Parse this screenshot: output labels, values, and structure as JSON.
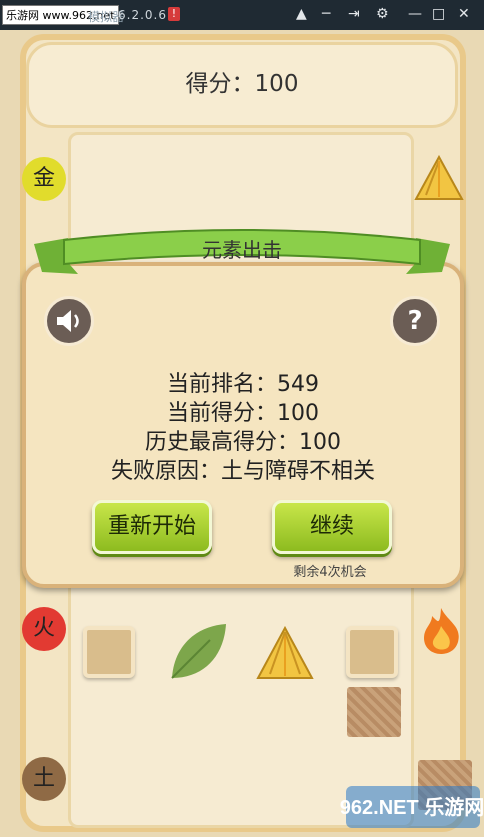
{
  "topbar": {
    "watermark": "乐游网 www.962.net",
    "app_title": "模拟器",
    "version": "6.2.0.6",
    "alert_badge": "!",
    "controls": [
      "shirt-icon",
      "minimize-icon",
      "pin-icon",
      "gear-icon",
      "maximize-icon",
      "close-icon"
    ]
  },
  "game": {
    "score_text": "得分：100",
    "elements": {
      "gold": "金",
      "fire": "火",
      "earth": "土"
    }
  },
  "dialog": {
    "title": "元素出击",
    "sound_icon": "speaker-icon",
    "help_label": "?",
    "rank_line": "当前排名：549",
    "score_line": "当前得分：100",
    "best_line": "历史最高得分：100",
    "reason_line": "失败原因：土与障碍不相关",
    "restart_label": "重新开始",
    "continue_label": "继续",
    "chances_text": "剩余4次机会"
  },
  "logo_text": "962.NET 乐游网",
  "colors": {
    "green_button": "#8dbb1f",
    "dialog_bg": "#f5e5c0",
    "gold": "#e1dc2c",
    "fire": "#e23a32",
    "earth": "#8f6a45"
  }
}
